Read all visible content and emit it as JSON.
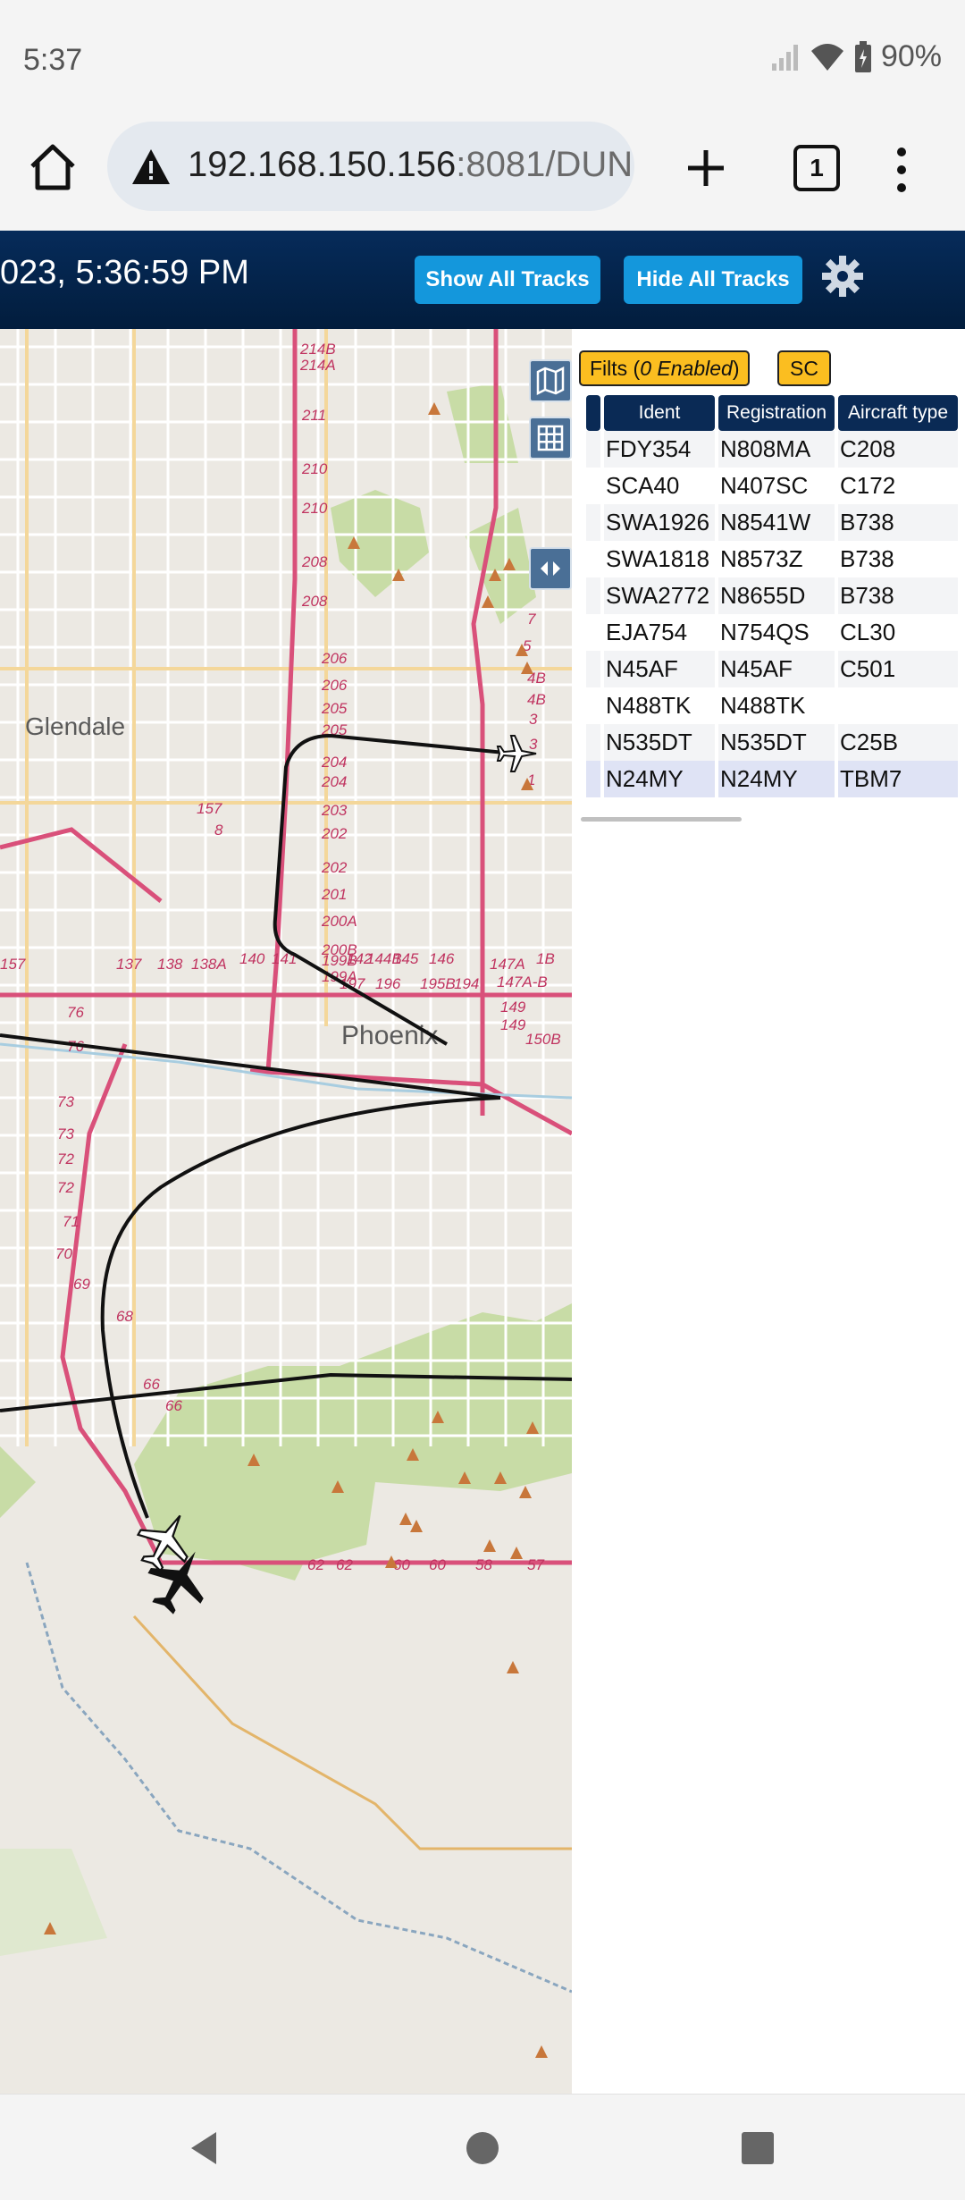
{
  "status": {
    "time": "5:37",
    "battery": "90%"
  },
  "browser": {
    "url_host": "192.168.150.156",
    "url_rest": ":8081/DUN",
    "tab_count": "1"
  },
  "header": {
    "datetime": "023, 5:36:59 PM",
    "show_tracks_label": "Show All Tracks",
    "hide_tracks_label": "Hide All Tracks"
  },
  "map": {
    "city_labels": [
      "Glendale",
      "Phoenix"
    ],
    "mile_markers": [
      "214B",
      "214A",
      "211",
      "210",
      "210",
      "208",
      "208",
      "206",
      "206",
      "205",
      "205",
      "204",
      "204",
      "203",
      "202",
      "202",
      "201",
      "200A",
      "200B",
      "199B",
      "199A",
      "197",
      "196",
      "195B",
      "194",
      "150B",
      "149",
      "149",
      "147A-B",
      "147A",
      "146",
      "145",
      "144B",
      "142",
      "141",
      "140",
      "138A",
      "138",
      "137",
      "157",
      "157",
      "8",
      "7",
      "5",
      "4B",
      "4B",
      "3",
      "3",
      "1",
      "1B",
      "76",
      "76",
      "73",
      "73",
      "72",
      "72",
      "71",
      "70",
      "69",
      "68",
      "66",
      "66",
      "62",
      "62",
      "60",
      "60",
      "58",
      "57"
    ]
  },
  "panel": {
    "filter_prefix": "Filts (",
    "filter_emph": "0 Enabled",
    "filter_suffix": ")",
    "sc_label": "SC",
    "columns": [
      "Ident",
      "Registration",
      "Aircraft type"
    ],
    "rows": [
      {
        "ident": "FDY354",
        "reg": "N808MA",
        "type": "C208"
      },
      {
        "ident": "SCA40",
        "reg": "N407SC",
        "type": "C172"
      },
      {
        "ident": "SWA1926",
        "reg": "N8541W",
        "type": "B738"
      },
      {
        "ident": "SWA1818",
        "reg": "N8573Z",
        "type": "B738"
      },
      {
        "ident": "SWA2772",
        "reg": "N8655D",
        "type": "B738"
      },
      {
        "ident": "EJA754",
        "reg": "N754QS",
        "type": "CL30"
      },
      {
        "ident": "N45AF",
        "reg": "N45AF",
        "type": "C501"
      },
      {
        "ident": "N488TK",
        "reg": "N488TK",
        "type": ""
      },
      {
        "ident": "N535DT",
        "reg": "N535DT",
        "type": "C25B"
      },
      {
        "ident": "N24MY",
        "reg": "N24MY",
        "type": "TBM7"
      }
    ]
  },
  "colors": {
    "header_bg": "#021d3d",
    "button_blue": "#1497dc",
    "filter_yellow": "#fbbe20",
    "highlight_orange": "#f0a000",
    "route_pink": "#d9507a",
    "park_green": "#c8dca6"
  },
  "icons": [
    "home-icon",
    "warning-icon",
    "plus-icon",
    "tabs-icon",
    "more-vert-icon",
    "gear-icon",
    "map-layers-icon",
    "grid-icon",
    "collapse-icon",
    "back-icon",
    "home-circle-icon",
    "recents-icon",
    "aircraft-icon"
  ]
}
